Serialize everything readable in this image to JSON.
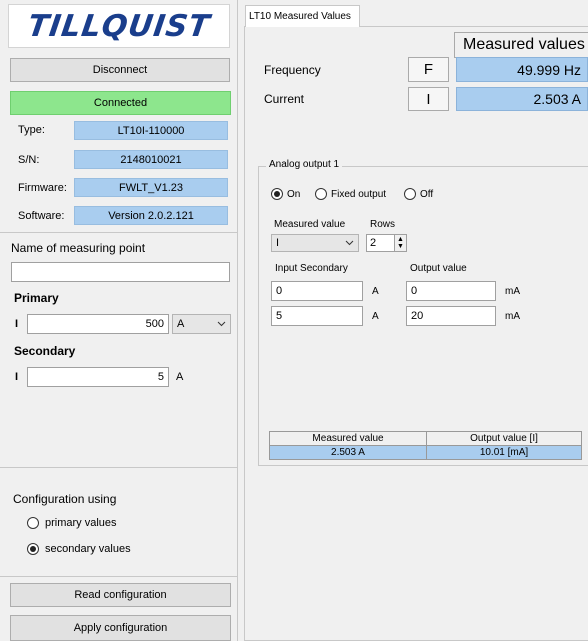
{
  "left": {
    "logo": "TILLQUIST",
    "disconnect_label": "Disconnect",
    "status": "Connected",
    "info": [
      {
        "label": "Type:",
        "value": "LT10I-110000"
      },
      {
        "label": "S/N:",
        "value": "2148010021"
      },
      {
        "label": "Firmware:",
        "value": "FWLT_V1.23"
      },
      {
        "label": "Software:",
        "value": "Version 2.0.2.121"
      }
    ],
    "measuring_point_label": "Name of measuring point",
    "measuring_point_value": "",
    "primary_label": "Primary",
    "primary_sym": "I",
    "primary_value": "500",
    "primary_unit": "A",
    "secondary_label": "Secondary",
    "secondary_sym": "I",
    "secondary_value": "5",
    "secondary_unit": "A",
    "config_using_label": "Configuration using",
    "primary_values_label": "primary values",
    "secondary_values_label": "secondary values",
    "read_config_label": "Read configuration",
    "apply_config_label": "Apply configuration"
  },
  "right": {
    "tab_label": "LT10 Measured Values",
    "measured_values_header": "Measured values",
    "rows": [
      {
        "label": "Frequency",
        "symbol": "F",
        "value": "49.999 Hz"
      },
      {
        "label": "Current",
        "symbol": "I",
        "value": "2.503 A"
      }
    ],
    "analog": {
      "title": "Analog output 1",
      "on_label": "On",
      "fixed_label": "Fixed output",
      "off_label": "Off",
      "measured_value_label": "Measured value",
      "measured_value_selected": "I",
      "rows_label": "Rows",
      "rows_value": "2",
      "input_secondary_label": "Input Secondary",
      "output_value_label": "Output value",
      "inputs": [
        {
          "input": "0",
          "input_unit": "A",
          "output": "0",
          "output_unit": "mA"
        },
        {
          "input": "5",
          "input_unit": "A",
          "output": "20",
          "output_unit": "mA"
        }
      ],
      "result_header_1": "Measured value",
      "result_header_2": "Output value [I]",
      "result_value_1": "2.503 A",
      "result_value_2": "10.01 [mA]"
    }
  },
  "colors": {
    "connected_green": "#8de68d",
    "value_blue": "#a9cdef",
    "logo_blue": "#1a3e8c"
  }
}
